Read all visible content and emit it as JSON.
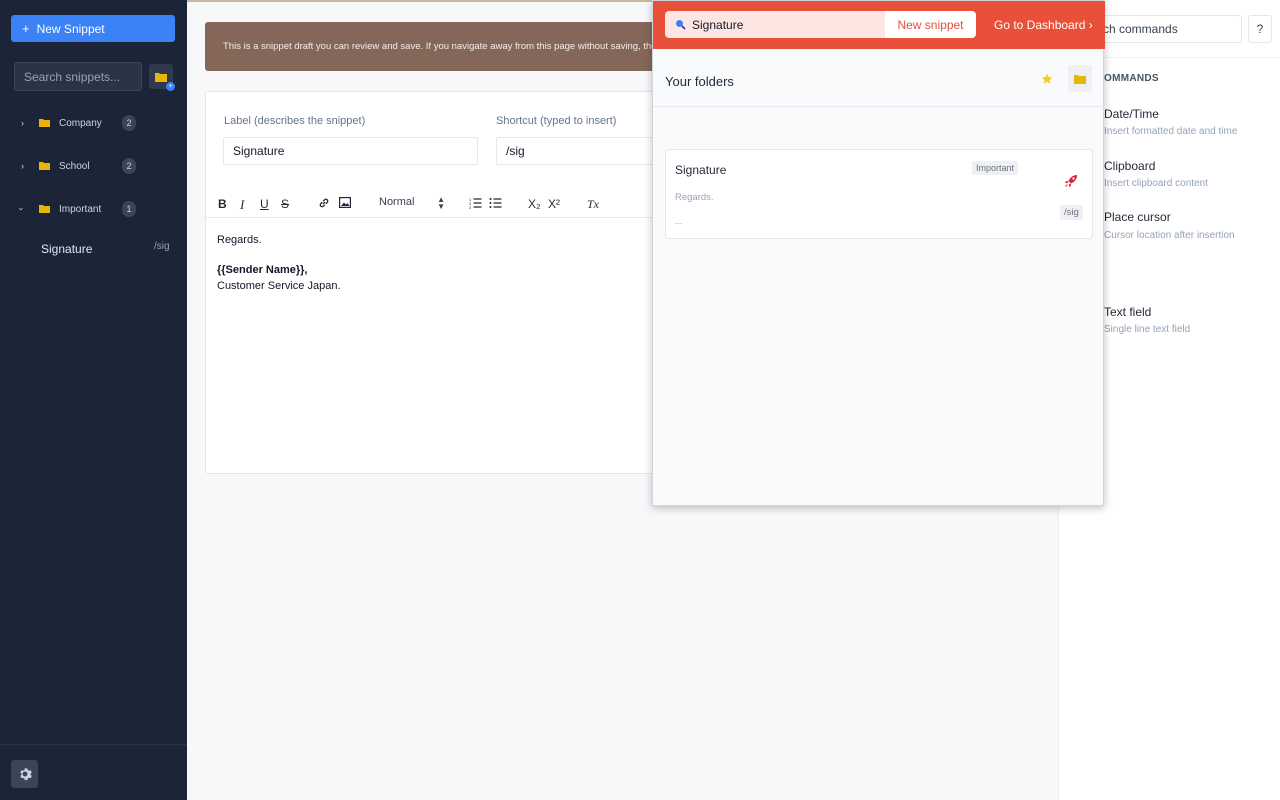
{
  "sidebar": {
    "new_snippet_label": "New Snippet",
    "search_placeholder": "Search snippets...",
    "folders": [
      {
        "name": "Company",
        "count": "2",
        "expanded": false
      },
      {
        "name": "School",
        "count": "2",
        "expanded": false
      },
      {
        "name": "Important",
        "count": "1",
        "expanded": true
      }
    ],
    "snippets": [
      {
        "name": "Signature",
        "shortcut": "/sig"
      }
    ]
  },
  "main": {
    "banner_text": "This is a snippet draft you can review and save. If you navigate away from this page without saving, the draft",
    "label_field": {
      "label": "Label (describes the snippet)",
      "value": "Signature"
    },
    "shortcut_field": {
      "label": "Shortcut (typed to insert)",
      "value": "/sig"
    },
    "toolbar": {
      "bold": "B",
      "italic": "I",
      "underline": "U",
      "strike": "S",
      "format_select": "Normal",
      "subscript": "X₂",
      "superscript": "X²",
      "clear": "Tx"
    },
    "body": {
      "line1": "Regards.",
      "line2": "{{Sender Name}},",
      "line3": "Customer Service Japan."
    }
  },
  "right_panel": {
    "search_value": "ch commands",
    "help_label": "?",
    "heading": "OMMANDS",
    "commands": [
      {
        "title": "Date/Time",
        "desc": "Insert formatted date and time"
      },
      {
        "title": "Clipboard",
        "desc": "Insert clipboard content"
      },
      {
        "title": "Place cursor",
        "desc": "Cursor location after insertion"
      },
      {
        "title": "Text field",
        "desc": "Single line text field"
      }
    ]
  },
  "popup": {
    "search_value": "Signature",
    "new_snippet_label": "New snippet",
    "dashboard_label": "Go to Dashboard ›",
    "folders_title": "Your folders",
    "result": {
      "title": "Signature",
      "tag": "Important",
      "preview": "Regards.",
      "ellipsis": "...",
      "shortcut": "/sig"
    }
  },
  "colors": {
    "sidebar_bg": "#1c2538",
    "accent_blue": "#3b82f6",
    "popup_header": "#e8503a",
    "banner": "#85675a",
    "folder_yellow": "#eab308"
  }
}
